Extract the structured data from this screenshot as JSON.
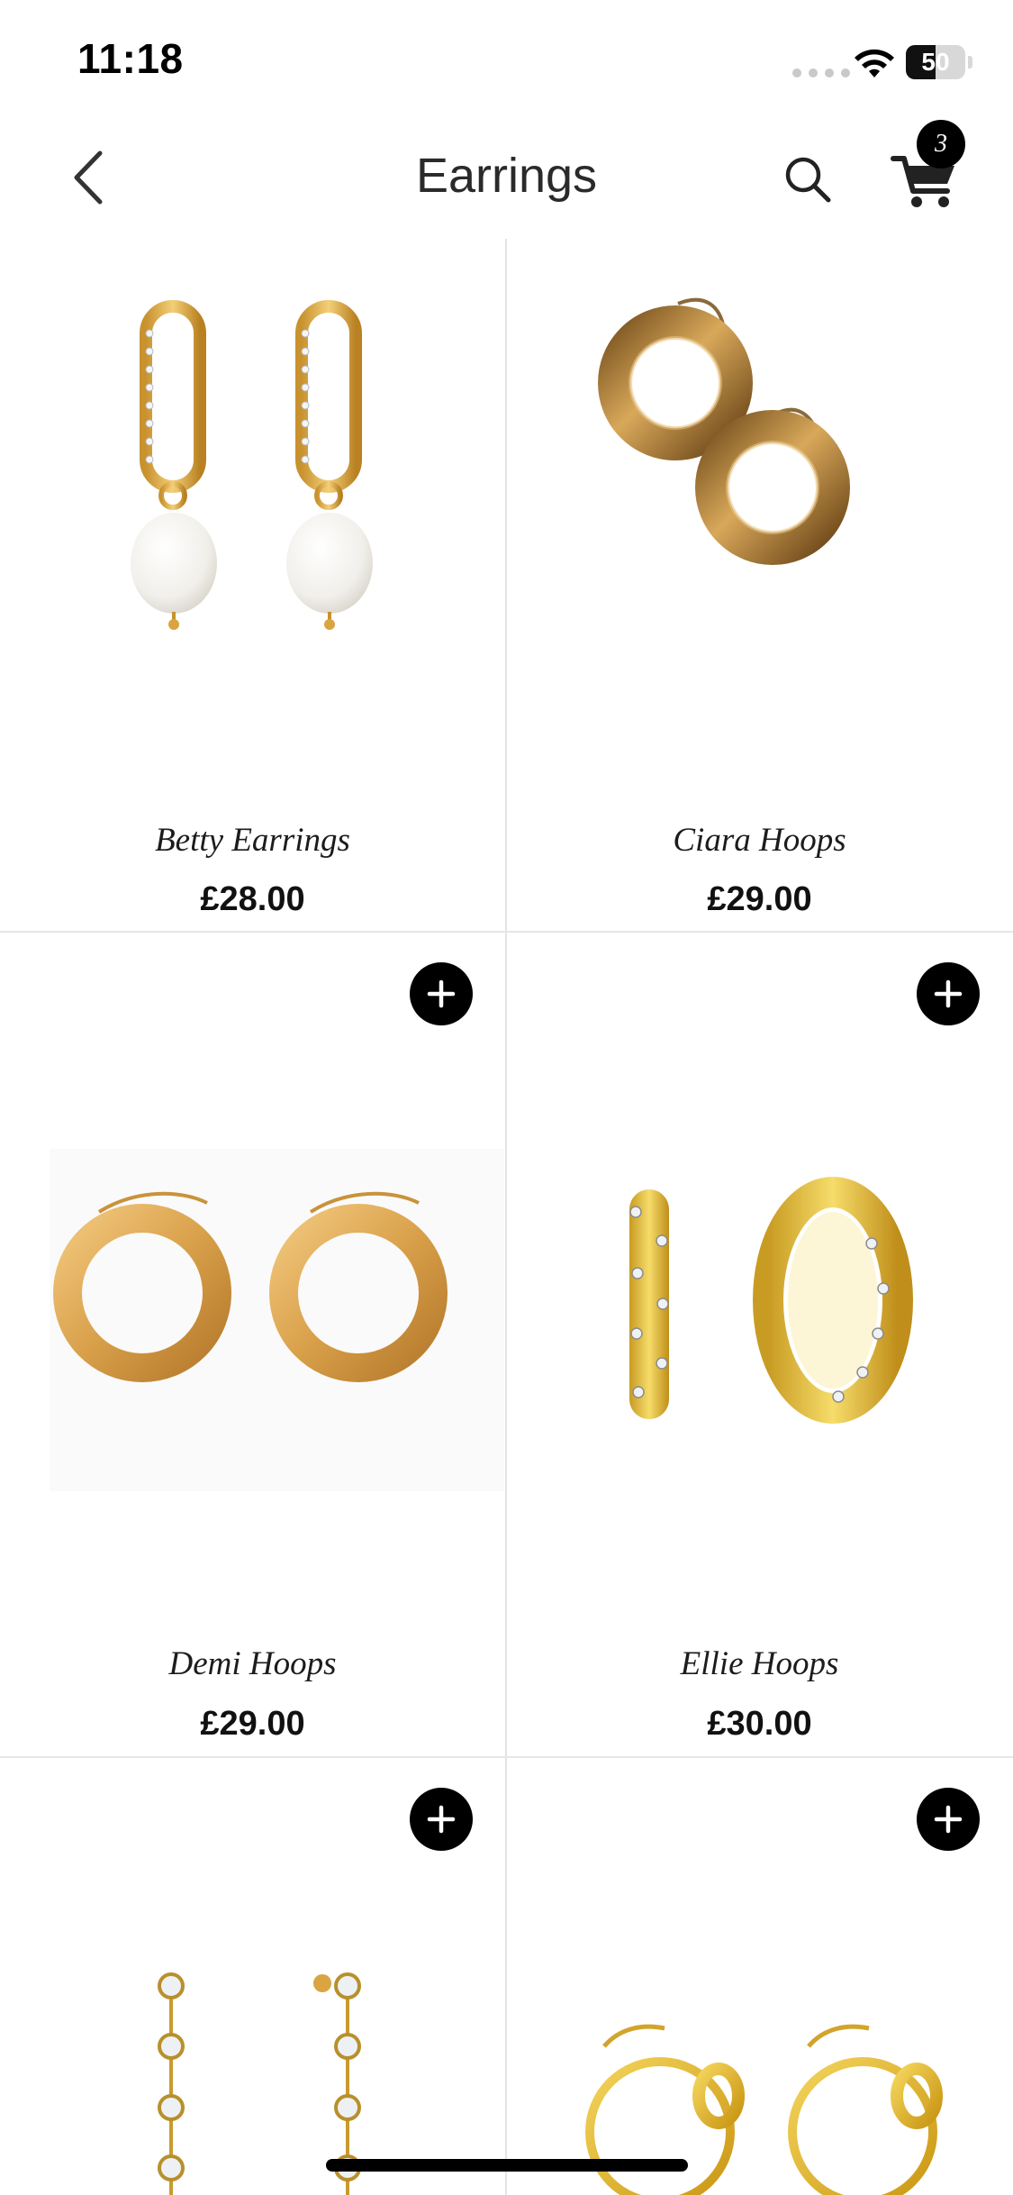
{
  "status_bar": {
    "time": "11:18",
    "battery": "50",
    "battery_level": 0.5
  },
  "nav": {
    "title": "Earrings",
    "back_icon": "chevron-left-icon",
    "search_icon": "search-icon",
    "cart_icon": "cart-icon",
    "cart_count": "3"
  },
  "products": [
    {
      "name": "Betty Earrings",
      "price": "£28.00",
      "image": "pearl-drop-earrings-image",
      "has_add_button": false
    },
    {
      "name": "Ciara Hoops",
      "price": "£29.00",
      "image": "chunky-gold-hoops-image",
      "has_add_button": false
    },
    {
      "name": "Demi Hoops",
      "price": "£29.00",
      "image": "gold-hoops-image",
      "has_add_button": true
    },
    {
      "name": "Ellie Hoops",
      "price": "£30.00",
      "image": "crystal-huggie-hoops-image",
      "has_add_button": true
    },
    {
      "name": "",
      "price": "",
      "image": "crystal-drop-earrings-image",
      "has_add_button": true
    },
    {
      "name": "",
      "price": "",
      "image": "knot-hoops-image",
      "has_add_button": true
    }
  ],
  "colors": {
    "gold": "#d9a441",
    "gold_light": "#f0cc7a",
    "gold_dark": "#a8741f",
    "pearl": "#f6f4f0",
    "accent": "#000000"
  }
}
